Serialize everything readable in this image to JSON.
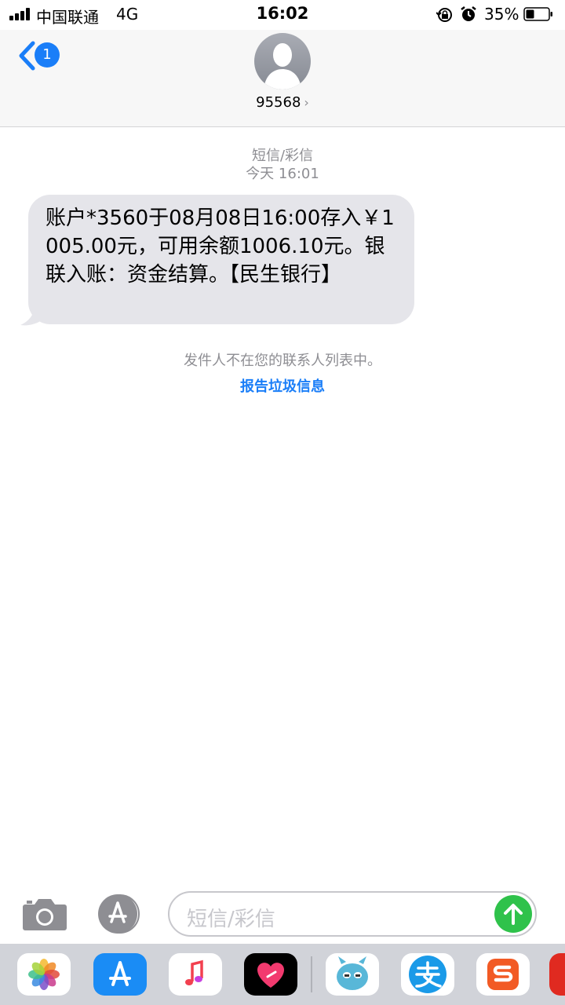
{
  "status_bar": {
    "carrier": "中国联通",
    "network": "4G",
    "time": "16:02",
    "battery": "35%"
  },
  "header": {
    "back_badge": "1",
    "contact_name": "95568",
    "chevron": "›"
  },
  "conversation": {
    "message_type": "短信/彩信",
    "timestamp": "今天 16:01",
    "message_text": "账户*3560于08月08日16:00存入￥1005.00元，可用余额1006.10元。银联入账：资金结算。【民生银行】",
    "sender_note": "发件人不在您的联系人列表中。",
    "report_link": "报告垃圾信息"
  },
  "input_bar": {
    "placeholder": "短信/彩信"
  },
  "app_drawer": {
    "apps": [
      {
        "icon": "photos-icon"
      },
      {
        "icon": "app-store-icon"
      },
      {
        "icon": "music-icon"
      },
      {
        "icon": "digital-touch-icon"
      },
      {
        "icon": "sticker-monster-icon"
      },
      {
        "icon": "alipay-icon"
      },
      {
        "icon": "sogou-icon"
      },
      {
        "icon": "partial-app-icon"
      }
    ]
  },
  "colors": {
    "accent_blue": "#1a7ef8",
    "bubble_gray": "#e5e5ea",
    "send_green": "#2fc24b",
    "meta_gray": "#8e8e93"
  }
}
